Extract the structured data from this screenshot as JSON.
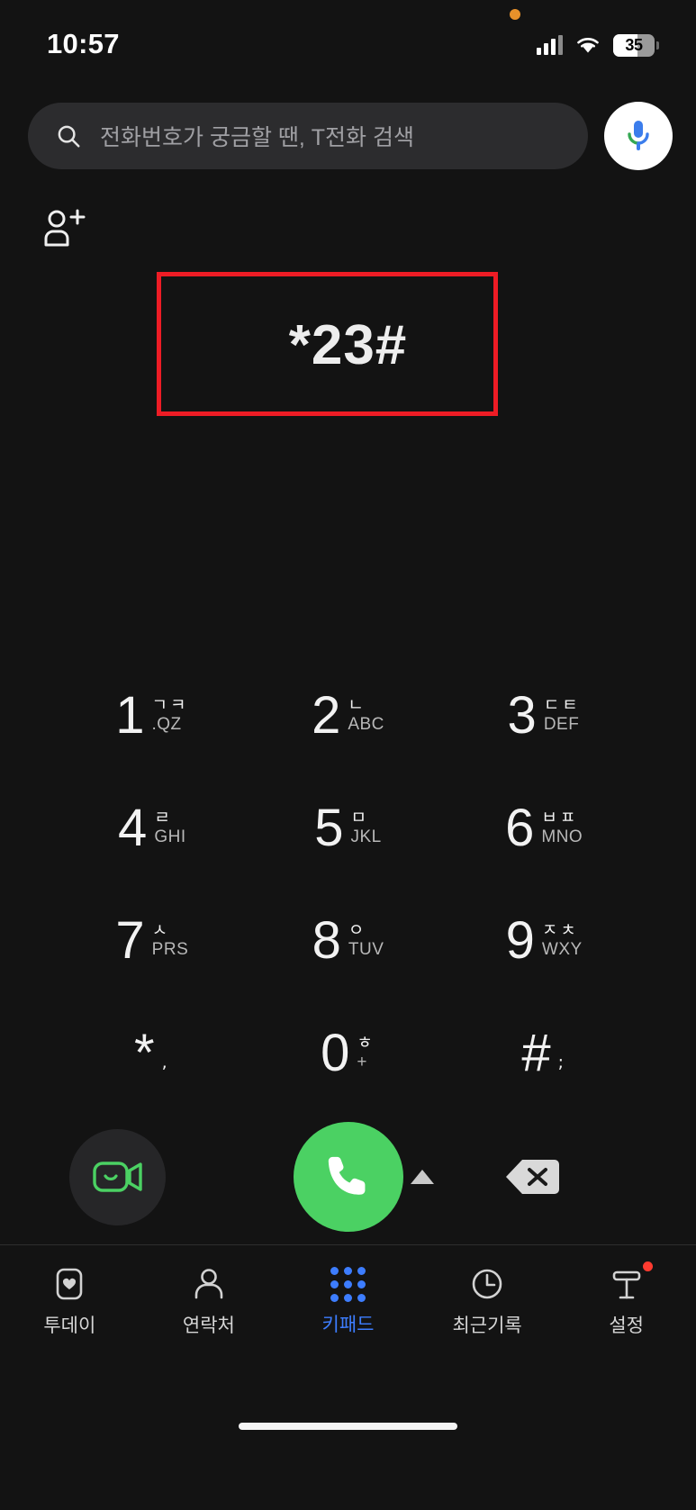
{
  "status_bar": {
    "time": "10:57",
    "battery_percent": "35",
    "privacy_indicator": "orange-dot",
    "signal_icon": "cellular-signal-icon",
    "wifi_icon": "wifi-icon"
  },
  "search": {
    "placeholder": "전화번호가 궁금할 땐, T전화 검색",
    "value": "",
    "search_icon": "search-icon",
    "mic_icon": "microphone-icon"
  },
  "header": {
    "add_contact_icon": "add-contact-icon"
  },
  "display": {
    "dialed_number": "*23#",
    "annotation_color": "#ee1c25"
  },
  "keypad": {
    "keys": [
      {
        "digit": "1",
        "korean": "ㄱㅋ",
        "latin": ".QZ"
      },
      {
        "digit": "2",
        "korean": "ㄴ",
        "latin": "ABC"
      },
      {
        "digit": "3",
        "korean": "ㄷㅌ",
        "latin": "DEF"
      },
      {
        "digit": "4",
        "korean": "ㄹ",
        "latin": "GHI"
      },
      {
        "digit": "5",
        "korean": "ㅁ",
        "latin": "JKL"
      },
      {
        "digit": "6",
        "korean": "ㅂㅍ",
        "latin": "MNO"
      },
      {
        "digit": "7",
        "korean": "ㅅ",
        "latin": "PRS"
      },
      {
        "digit": "8",
        "korean": "ㅇ",
        "latin": "TUV"
      },
      {
        "digit": "9",
        "korean": "ㅈㅊ",
        "latin": "WXY"
      },
      {
        "digit": "*",
        "korean": ",",
        "latin": ""
      },
      {
        "digit": "0",
        "korean": "ㅎ",
        "latin": "+"
      },
      {
        "digit": "#",
        "korean": ";",
        "latin": ""
      }
    ]
  },
  "actions": {
    "video_call_icon": "video-call-icon",
    "call_icon": "phone-call-icon",
    "expand_icon": "chevron-up-icon",
    "delete_icon": "backspace-icon",
    "call_button_color": "#4bd163",
    "video_icon_color": "#4bd163"
  },
  "bottom_nav": {
    "active_color": "#3d7dff",
    "items": [
      {
        "label": "투데이",
        "icon": "today-heart-icon",
        "active": false,
        "badge": false
      },
      {
        "label": "연락처",
        "icon": "contacts-person-icon",
        "active": false,
        "badge": false
      },
      {
        "label": "키패드",
        "icon": "keypad-dots-icon",
        "active": true,
        "badge": false
      },
      {
        "label": "최근기록",
        "icon": "recent-clock-icon",
        "active": false,
        "badge": false
      },
      {
        "label": "설정",
        "icon": "settings-t-icon",
        "active": false,
        "badge": true
      }
    ]
  }
}
